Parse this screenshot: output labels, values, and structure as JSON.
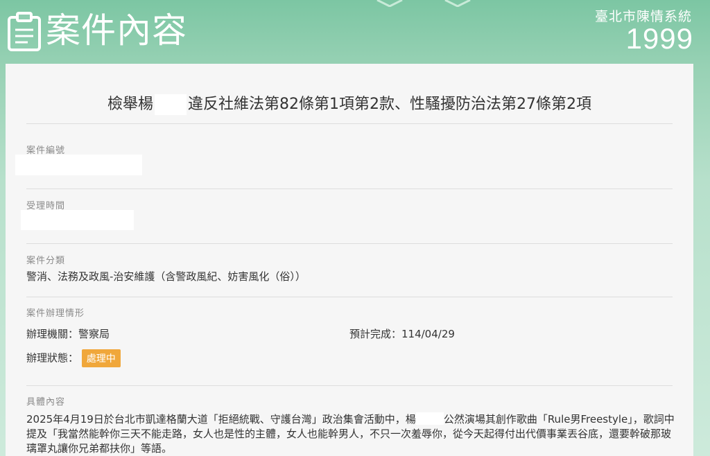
{
  "header": {
    "title": "案件內容",
    "system_name": "臺北市陳情系統",
    "hotline": "1999"
  },
  "case": {
    "title_prefix": "檢舉楊",
    "title_suffix": "違反社維法第82條第1項第2款、性騷擾防治法第27條第2項",
    "number_label": "案件編號",
    "received_label": "受理時間",
    "category_label": "案件分類",
    "category_value": "警消、法務及政風-治安維護（含警政風紀、妨害風化（俗））",
    "status_section_label": "案件辦理情形",
    "agency": "辦理機關：警察局",
    "expected": "預計完成：114/04/29",
    "status_label": "辦理狀態：",
    "status_badge": "處理中",
    "detail_label": "具體內容",
    "detail_part1": "2025年4月19日於台北市凱達格蘭大道「拒絕統戰、守護台灣」政治集會活動中，楊",
    "detail_part2": "公然演場其創作歌曲「Rule男Freestyle」，歌詞中提及「我當然能幹你三天不能走路，女人也是性的主體，女人也能幹男人，不只一次羞辱你，從今天起得付出代價事業丟谷底，還要幹破那玻璃罩丸讓你兄弟都扶你」等語。"
  },
  "colors": {
    "header_green": "#7cc6a3",
    "badge_orange": "#f0a73b",
    "card_bg": "#f6f6f6"
  }
}
